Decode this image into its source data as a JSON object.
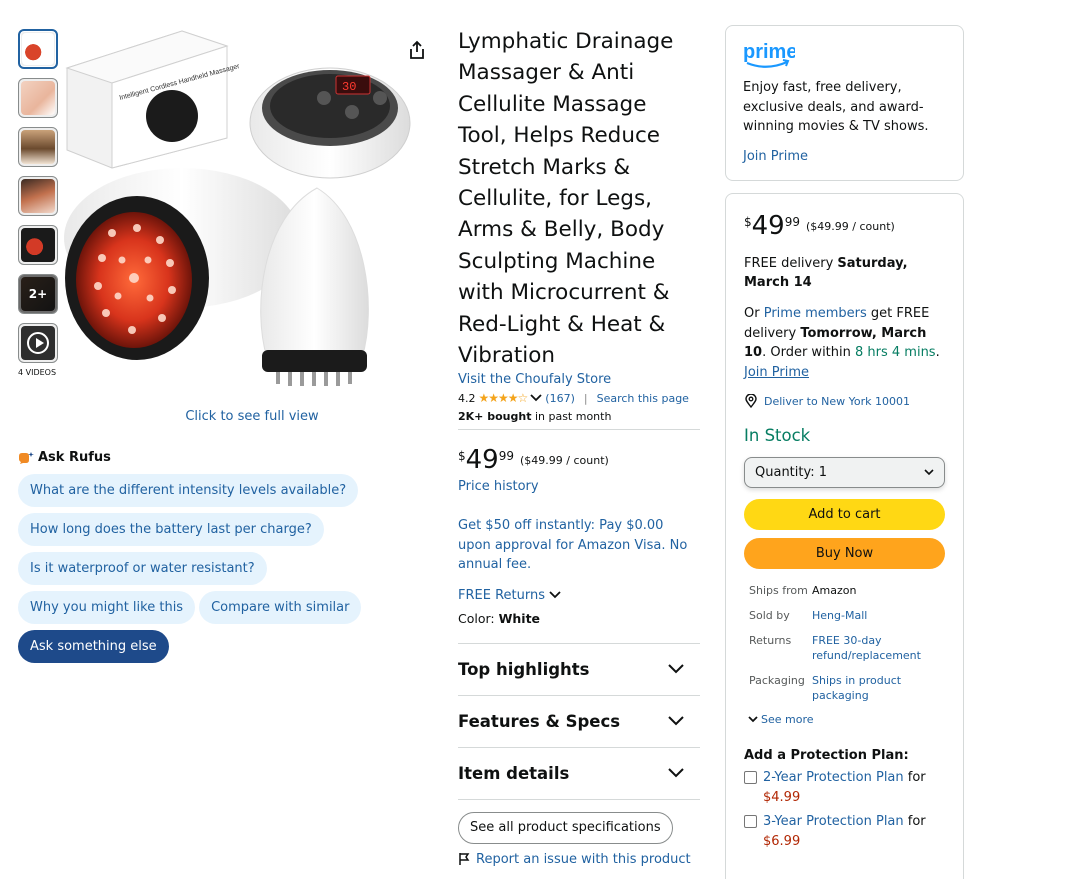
{
  "gallery": {
    "videos_label": "4 VIDEOS",
    "more_label": "2+",
    "full_view_label": "Click to see full view",
    "box_text": "Intelligent Cordless Handheld Massager",
    "display_digits": "30"
  },
  "rufus": {
    "title": "Ask Rufus",
    "chips": [
      "What are the different intensity levels available?",
      "How long does the battery last per charge?",
      "Is it waterproof or water resistant?",
      "Why you might like this",
      "Compare with similar",
      "Ask something else"
    ]
  },
  "product": {
    "title": "Lymphatic Drainage Massager & Anti Cellulite Massage Tool, Helps Reduce Stretch Marks & Cellulite, for Legs, Arms & Belly, Body Sculpting Machine with Microcurrent & Red-Light & Heat & Vibration",
    "store_link": "Visit the Choufaly Store",
    "rating": "4.2",
    "stars": "★★★★☆",
    "review_count": "(167)",
    "search_page": "Search this page",
    "bought_bold": "2K+ bought",
    "bought_rest": " in past month",
    "price_symbol": "$",
    "price_whole": "49",
    "price_fraction": "99",
    "price_unit": "($49.99 / count)",
    "price_history": "Price history",
    "promo": "Get $50 off instantly: Pay $0.00 upon approval for Amazon Visa. No annual fee.",
    "returns": "FREE Returns",
    "color_label": "Color: ",
    "color_value": "White",
    "accordion": [
      "Top highlights",
      "Features & Specs",
      "Item details"
    ],
    "specs_button": "See all product specifications",
    "report": "Report an issue with this product"
  },
  "prime": {
    "logo_text": "prime",
    "text": "Enjoy fast, free delivery, exclusive deals, and award-winning movies & TV shows.",
    "join": "Join Prime"
  },
  "buybox": {
    "price_symbol": "$",
    "price_whole": "49",
    "price_fraction": "99",
    "price_unit": "($49.99 / count)",
    "delivery_prefix": "FREE delivery ",
    "delivery_date": "Saturday, March 14",
    "or": "Or ",
    "prime_members": "Prime members",
    "get_free": " get FREE delivery ",
    "fast_date": "Tomorrow, March 10",
    "order_within": ". Order within ",
    "countdown": "8 hrs 4 mins",
    "join_prime": "Join Prime",
    "deliver_to": "Deliver to New York 10001",
    "stock": "In Stock",
    "quantity_label": "Quantity:",
    "quantity_value": "1",
    "add_to_cart": "Add to cart",
    "buy_now": "Buy Now",
    "info": [
      {
        "k": "Ships from",
        "v": "Amazon",
        "link": false
      },
      {
        "k": "Sold by",
        "v": "Heng-Mall",
        "link": true
      },
      {
        "k": "Returns",
        "v": "FREE 30-day refund/replacement",
        "link": true
      },
      {
        "k": "Packaging",
        "v": "Ships in product packaging",
        "link": true
      }
    ],
    "see_more": "See more",
    "protection_title": "Add a Protection Plan:",
    "plans": [
      {
        "name": "2-Year Protection Plan",
        "for": " for",
        "price": "$4.99"
      },
      {
        "name": "3-Year Protection Plan",
        "for": " for",
        "price": "$6.99"
      }
    ]
  },
  "colors": {
    "link": "#2162a1",
    "add_to_cart": "#ffd814",
    "buy_now": "#ffa41c",
    "in_stock": "#067d62",
    "price_red": "#b12704",
    "chip_bg": "#e5f3fd"
  }
}
